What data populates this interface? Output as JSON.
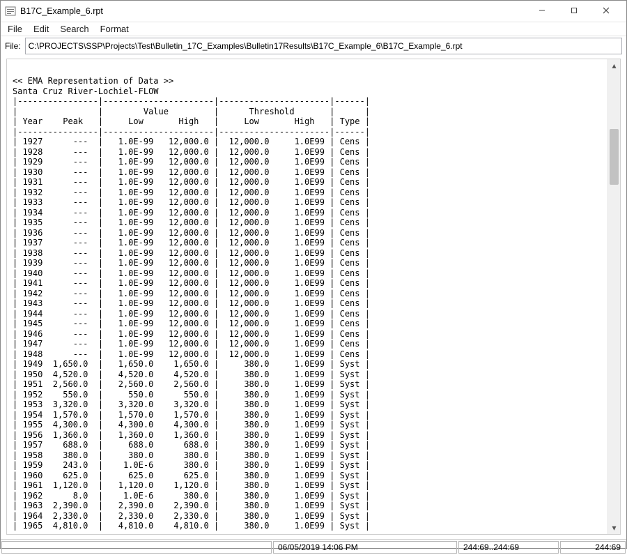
{
  "window": {
    "title": "B17C_Example_6.rpt"
  },
  "menu": {
    "file": "File",
    "edit": "Edit",
    "search": "Search",
    "format": "Format"
  },
  "filerow": {
    "label": "File:",
    "path": "C:\\PROJECTS\\SSP\\Projects\\Test\\Bulletin_17C_Examples\\Bulletin17Results\\B17C_Example_6\\B17C_Example_6.rpt"
  },
  "report": {
    "banner": "<< EMA Representation of Data >>",
    "station": "Santa Cruz River-Lochiel-FLOW",
    "hline": "|----------------|----------------------|----------------------|------|",
    "hdr1": "|                |        Value         |      Threshold       |      |",
    "hdr2": "| Year    Peak   |     Low       High   |     Low       High   | Type |"
  },
  "rows": [
    {
      "year": 1927,
      "peak": "    ---",
      "vlow": "1.0E-99",
      "vhigh": "12,000.0",
      "tlow": "12,000.0",
      "thigh": "1.0E99",
      "type": "Cens"
    },
    {
      "year": 1928,
      "peak": "    ---",
      "vlow": "1.0E-99",
      "vhigh": "12,000.0",
      "tlow": "12,000.0",
      "thigh": "1.0E99",
      "type": "Cens"
    },
    {
      "year": 1929,
      "peak": "    ---",
      "vlow": "1.0E-99",
      "vhigh": "12,000.0",
      "tlow": "12,000.0",
      "thigh": "1.0E99",
      "type": "Cens"
    },
    {
      "year": 1930,
      "peak": "    ---",
      "vlow": "1.0E-99",
      "vhigh": "12,000.0",
      "tlow": "12,000.0",
      "thigh": "1.0E99",
      "type": "Cens"
    },
    {
      "year": 1931,
      "peak": "    ---",
      "vlow": "1.0E-99",
      "vhigh": "12,000.0",
      "tlow": "12,000.0",
      "thigh": "1.0E99",
      "type": "Cens"
    },
    {
      "year": 1932,
      "peak": "    ---",
      "vlow": "1.0E-99",
      "vhigh": "12,000.0",
      "tlow": "12,000.0",
      "thigh": "1.0E99",
      "type": "Cens"
    },
    {
      "year": 1933,
      "peak": "    ---",
      "vlow": "1.0E-99",
      "vhigh": "12,000.0",
      "tlow": "12,000.0",
      "thigh": "1.0E99",
      "type": "Cens"
    },
    {
      "year": 1934,
      "peak": "    ---",
      "vlow": "1.0E-99",
      "vhigh": "12,000.0",
      "tlow": "12,000.0",
      "thigh": "1.0E99",
      "type": "Cens"
    },
    {
      "year": 1935,
      "peak": "    ---",
      "vlow": "1.0E-99",
      "vhigh": "12,000.0",
      "tlow": "12,000.0",
      "thigh": "1.0E99",
      "type": "Cens"
    },
    {
      "year": 1936,
      "peak": "    ---",
      "vlow": "1.0E-99",
      "vhigh": "12,000.0",
      "tlow": "12,000.0",
      "thigh": "1.0E99",
      "type": "Cens"
    },
    {
      "year": 1937,
      "peak": "    ---",
      "vlow": "1.0E-99",
      "vhigh": "12,000.0",
      "tlow": "12,000.0",
      "thigh": "1.0E99",
      "type": "Cens"
    },
    {
      "year": 1938,
      "peak": "    ---",
      "vlow": "1.0E-99",
      "vhigh": "12,000.0",
      "tlow": "12,000.0",
      "thigh": "1.0E99",
      "type": "Cens"
    },
    {
      "year": 1939,
      "peak": "    ---",
      "vlow": "1.0E-99",
      "vhigh": "12,000.0",
      "tlow": "12,000.0",
      "thigh": "1.0E99",
      "type": "Cens"
    },
    {
      "year": 1940,
      "peak": "    ---",
      "vlow": "1.0E-99",
      "vhigh": "12,000.0",
      "tlow": "12,000.0",
      "thigh": "1.0E99",
      "type": "Cens"
    },
    {
      "year": 1941,
      "peak": "    ---",
      "vlow": "1.0E-99",
      "vhigh": "12,000.0",
      "tlow": "12,000.0",
      "thigh": "1.0E99",
      "type": "Cens"
    },
    {
      "year": 1942,
      "peak": "    ---",
      "vlow": "1.0E-99",
      "vhigh": "12,000.0",
      "tlow": "12,000.0",
      "thigh": "1.0E99",
      "type": "Cens"
    },
    {
      "year": 1943,
      "peak": "    ---",
      "vlow": "1.0E-99",
      "vhigh": "12,000.0",
      "tlow": "12,000.0",
      "thigh": "1.0E99",
      "type": "Cens"
    },
    {
      "year": 1944,
      "peak": "    ---",
      "vlow": "1.0E-99",
      "vhigh": "12,000.0",
      "tlow": "12,000.0",
      "thigh": "1.0E99",
      "type": "Cens"
    },
    {
      "year": 1945,
      "peak": "    ---",
      "vlow": "1.0E-99",
      "vhigh": "12,000.0",
      "tlow": "12,000.0",
      "thigh": "1.0E99",
      "type": "Cens"
    },
    {
      "year": 1946,
      "peak": "    ---",
      "vlow": "1.0E-99",
      "vhigh": "12,000.0",
      "tlow": "12,000.0",
      "thigh": "1.0E99",
      "type": "Cens"
    },
    {
      "year": 1947,
      "peak": "    ---",
      "vlow": "1.0E-99",
      "vhigh": "12,000.0",
      "tlow": "12,000.0",
      "thigh": "1.0E99",
      "type": "Cens"
    },
    {
      "year": 1948,
      "peak": "    ---",
      "vlow": "1.0E-99",
      "vhigh": "12,000.0",
      "tlow": "12,000.0",
      "thigh": "1.0E99",
      "type": "Cens"
    },
    {
      "year": 1949,
      "peak": "1,650.0",
      "vlow": "1,650.0",
      "vhigh": " 1,650.0",
      "tlow": "   380.0",
      "thigh": "1.0E99",
      "type": "Syst"
    },
    {
      "year": 1950,
      "peak": "4,520.0",
      "vlow": "4,520.0",
      "vhigh": " 4,520.0",
      "tlow": "   380.0",
      "thigh": "1.0E99",
      "type": "Syst"
    },
    {
      "year": 1951,
      "peak": "2,560.0",
      "vlow": "2,560.0",
      "vhigh": " 2,560.0",
      "tlow": "   380.0",
      "thigh": "1.0E99",
      "type": "Syst"
    },
    {
      "year": 1952,
      "peak": "  550.0",
      "vlow": "  550.0",
      "vhigh": "   550.0",
      "tlow": "   380.0",
      "thigh": "1.0E99",
      "type": "Syst"
    },
    {
      "year": 1953,
      "peak": "3,320.0",
      "vlow": "3,320.0",
      "vhigh": " 3,320.0",
      "tlow": "   380.0",
      "thigh": "1.0E99",
      "type": "Syst"
    },
    {
      "year": 1954,
      "peak": "1,570.0",
      "vlow": "1,570.0",
      "vhigh": " 1,570.0",
      "tlow": "   380.0",
      "thigh": "1.0E99",
      "type": "Syst"
    },
    {
      "year": 1955,
      "peak": "4,300.0",
      "vlow": "4,300.0",
      "vhigh": " 4,300.0",
      "tlow": "   380.0",
      "thigh": "1.0E99",
      "type": "Syst"
    },
    {
      "year": 1956,
      "peak": "1,360.0",
      "vlow": "1,360.0",
      "vhigh": " 1,360.0",
      "tlow": "   380.0",
      "thigh": "1.0E99",
      "type": "Syst"
    },
    {
      "year": 1957,
      "peak": "  688.0",
      "vlow": "  688.0",
      "vhigh": "   688.0",
      "tlow": "   380.0",
      "thigh": "1.0E99",
      "type": "Syst"
    },
    {
      "year": 1958,
      "peak": "  380.0",
      "vlow": "  380.0",
      "vhigh": "   380.0",
      "tlow": "   380.0",
      "thigh": "1.0E99",
      "type": "Syst"
    },
    {
      "year": 1959,
      "peak": "  243.0",
      "vlow": " 1.0E-6",
      "vhigh": "   380.0",
      "tlow": "   380.0",
      "thigh": "1.0E99",
      "type": "Syst"
    },
    {
      "year": 1960,
      "peak": "  625.0",
      "vlow": "  625.0",
      "vhigh": "   625.0",
      "tlow": "   380.0",
      "thigh": "1.0E99",
      "type": "Syst"
    },
    {
      "year": 1961,
      "peak": "1,120.0",
      "vlow": "1,120.0",
      "vhigh": " 1,120.0",
      "tlow": "   380.0",
      "thigh": "1.0E99",
      "type": "Syst"
    },
    {
      "year": 1962,
      "peak": "    8.0",
      "vlow": " 1.0E-6",
      "vhigh": "   380.0",
      "tlow": "   380.0",
      "thigh": "1.0E99",
      "type": "Syst"
    },
    {
      "year": 1963,
      "peak": "2,390.0",
      "vlow": "2,390.0",
      "vhigh": " 2,390.0",
      "tlow": "   380.0",
      "thigh": "1.0E99",
      "type": "Syst"
    },
    {
      "year": 1964,
      "peak": "2,330.0",
      "vlow": "2,330.0",
      "vhigh": " 2,330.0",
      "tlow": "   380.0",
      "thigh": "1.0E99",
      "type": "Syst"
    },
    {
      "year": 1965,
      "peak": "4,810.0",
      "vlow": "4,810.0",
      "vhigh": " 4,810.0",
      "tlow": "   380.0",
      "thigh": "1.0E99",
      "type": "Syst"
    }
  ],
  "status": {
    "date": "06/05/2019 14:06 PM",
    "rangecol": "244:69..244:69",
    "pos": "244:69"
  }
}
